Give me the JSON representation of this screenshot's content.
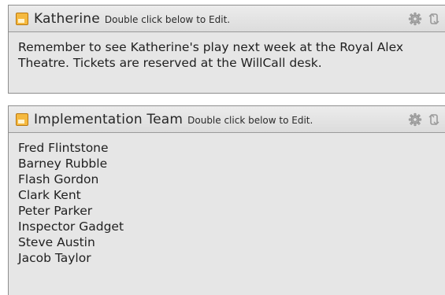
{
  "notes": [
    {
      "title": "Katherine",
      "hint": "Double click below to Edit.",
      "body_lines": [
        "Remember to see Katherine's play next week at the Royal Alex",
        "Theatre. Tickets are reserved at the WillCall desk."
      ]
    },
    {
      "title": "Implementation Team",
      "hint": "Double click below to Edit.",
      "body_lines": [
        "Fred Flintstone",
        "Barney Rubble",
        "Flash Gordon",
        "Clark Kent",
        "Peter Parker",
        "Inspector Gadget",
        "Steve Austin",
        "Jacob Taylor"
      ]
    }
  ],
  "icons": {
    "note": "note-icon",
    "settings": "gear-icon",
    "refresh": "rotate-icon"
  },
  "colors": {
    "panel_bg": "#e6e6e6",
    "border": "#8e8e8e",
    "note_icon": "#f5b940"
  }
}
